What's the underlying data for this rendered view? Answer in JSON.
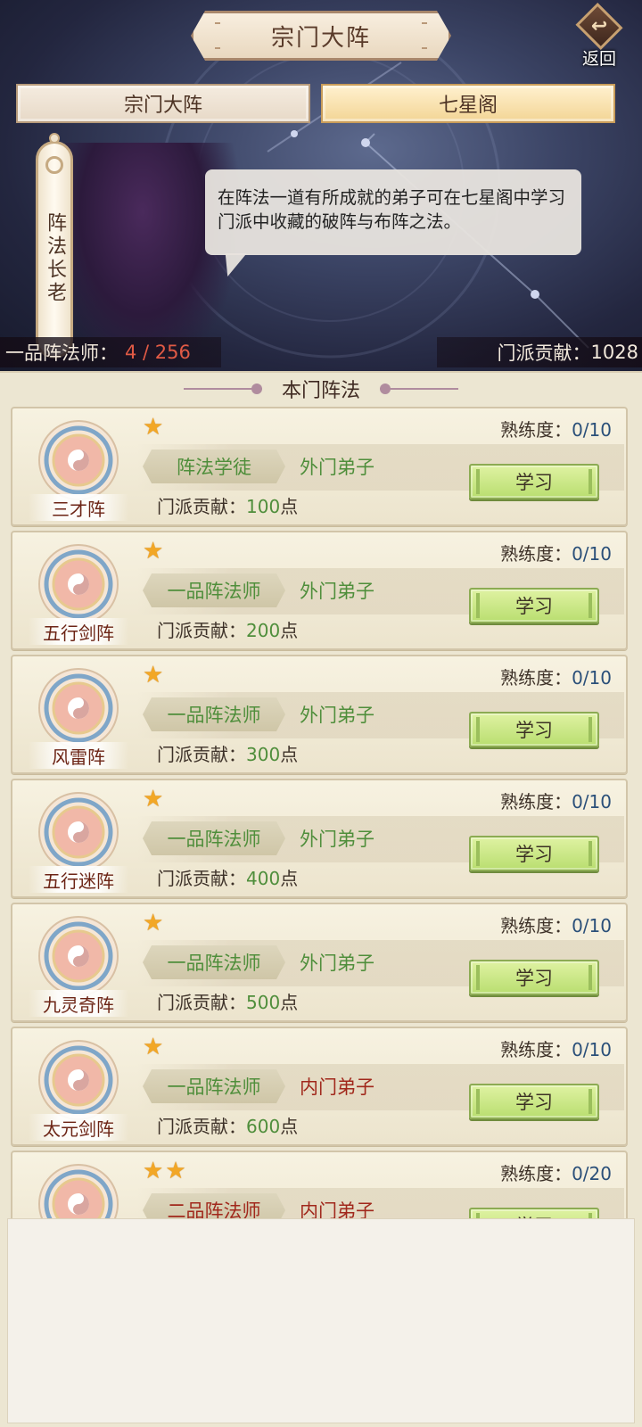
{
  "header": {
    "title": "宗门大阵",
    "back_label": "返回",
    "back_icon_glyph": "ट"
  },
  "tabs": [
    {
      "label": "宗门大阵",
      "active": false
    },
    {
      "label": "七星阁",
      "active": true
    }
  ],
  "npc": {
    "name": "阵法长老",
    "dialog": "在阵法一道有所成就的弟子可在七星阁中学习门派中收藏的破阵与布阵之法。"
  },
  "stats": {
    "rank_label": "一品阵法师：",
    "rank_value": "4 / 256",
    "contribution_label": "门派贡献：",
    "contribution_value": "1028"
  },
  "panel": {
    "title": "本门阵法",
    "proficiency_label": "熟练度：",
    "contribution_label": "门派贡献：",
    "learn_label": "学习",
    "points_suffix": "点"
  },
  "formations": [
    {
      "name": "三才阵",
      "stars": 1,
      "proficiency": "0/10",
      "rank": "阵法学徒",
      "rank_red": false,
      "disciple": "外门弟子",
      "disciple_red": false,
      "contribution": "100"
    },
    {
      "name": "五行剑阵",
      "stars": 1,
      "proficiency": "0/10",
      "rank": "一品阵法师",
      "rank_red": false,
      "disciple": "外门弟子",
      "disciple_red": false,
      "contribution": "200"
    },
    {
      "name": "风雷阵",
      "stars": 1,
      "proficiency": "0/10",
      "rank": "一品阵法师",
      "rank_red": false,
      "disciple": "外门弟子",
      "disciple_red": false,
      "contribution": "300"
    },
    {
      "name": "五行迷阵",
      "stars": 1,
      "proficiency": "0/10",
      "rank": "一品阵法师",
      "rank_red": false,
      "disciple": "外门弟子",
      "disciple_red": false,
      "contribution": "400"
    },
    {
      "name": "九灵奇阵",
      "stars": 1,
      "proficiency": "0/10",
      "rank": "一品阵法师",
      "rank_red": false,
      "disciple": "外门弟子",
      "disciple_red": false,
      "contribution": "500"
    },
    {
      "name": "太元剑阵",
      "stars": 1,
      "proficiency": "0/10",
      "rank": "一品阵法师",
      "rank_red": false,
      "disciple": "内门弟子",
      "disciple_red": true,
      "contribution": "600"
    },
    {
      "name": "",
      "stars": 2,
      "proficiency": "0/20",
      "rank": "二品阵法师",
      "rank_red": true,
      "disciple": "内门弟子",
      "disciple_red": true,
      "contribution": ""
    }
  ],
  "colors": {
    "green_text": "#4f8e3b",
    "red_text": "#a1281c",
    "proficiency_value": "#2a4f79",
    "star": "#f2a726"
  }
}
